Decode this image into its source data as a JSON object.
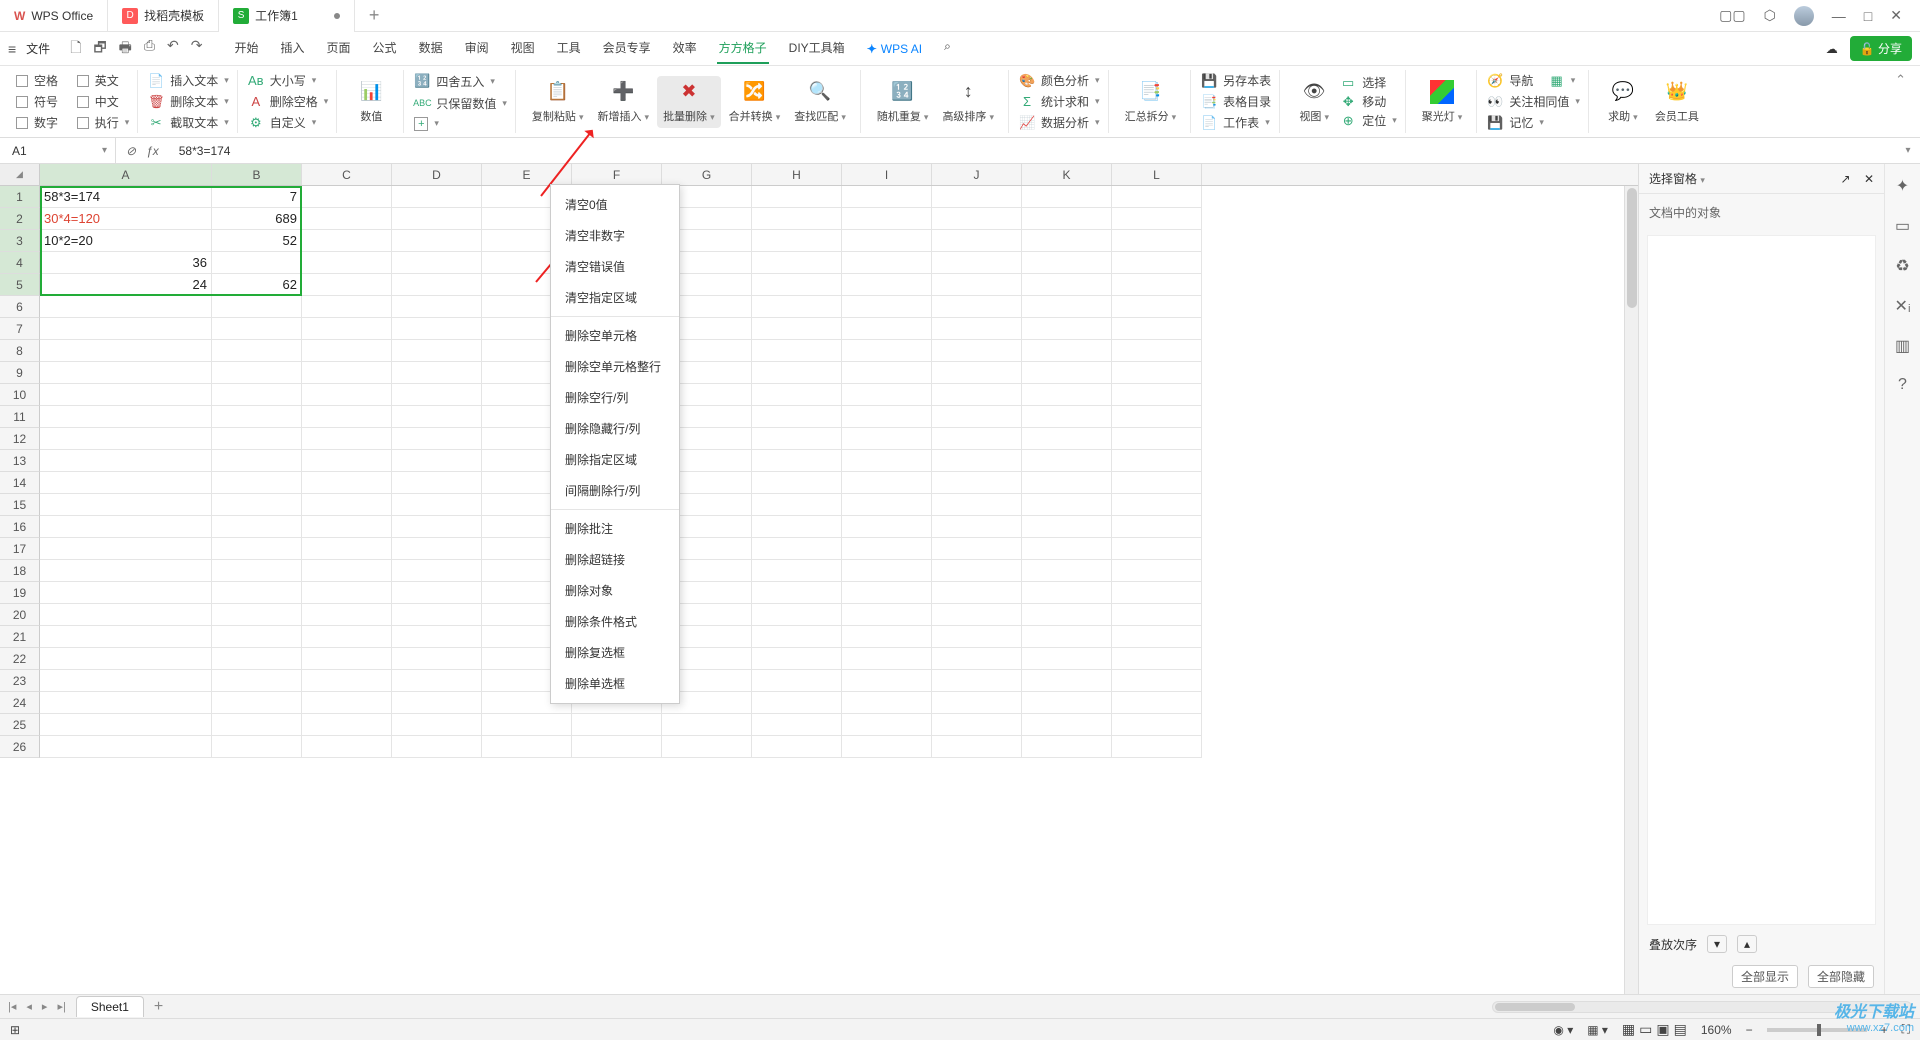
{
  "titlebar": {
    "app_name": "WPS Office",
    "tab_template": "找稻壳模板",
    "workbook": "工作簿1",
    "icons": {
      "cube": "⬡",
      "minimize": "—",
      "maxrestore": "▢▢",
      "maximize": "□",
      "close": "✕"
    }
  },
  "menubar": {
    "file": "文件",
    "quick": [
      "🗋",
      "🗗",
      "🖶",
      "⎙",
      "↶",
      "↷"
    ],
    "tabs": [
      "开始",
      "插入",
      "页面",
      "公式",
      "数据",
      "审阅",
      "视图",
      "工具",
      "会员专享",
      "效率",
      "方方格子",
      "DIY工具箱"
    ],
    "ai_label": "WPS AI",
    "search_icon": "⌕",
    "cloud_icon": "☁",
    "share": "分享"
  },
  "ribbon": {
    "g1": {
      "blank": "空格",
      "en": "英文",
      "sym": "符号",
      "cn": "中文",
      "num": "数字",
      "exec": "执行"
    },
    "g2": {
      "instxt": "插入文本",
      "deltxt": "删除文本",
      "cuttxt": "截取文本"
    },
    "g3": {
      "case": "大小写",
      "delsp": "删除空格",
      "custom": "自定义"
    },
    "g4": {
      "numval": "数值"
    },
    "g5": {
      "round": "四舍五入",
      "keepnum": "只保留数值",
      "plus": "+"
    },
    "g6": {
      "copypaste": "复制粘贴",
      "newins": "新增插入",
      "batchdel": "批量删除",
      "mergeconv": "合并转换",
      "findmatch": "查找匹配"
    },
    "g7": {
      "randrep": "随机重复",
      "advsort": "高级排序"
    },
    "g8": {
      "coloranalyze": "颜色分析",
      "statsum": "统计求和",
      "dataanalyze": "数据分析"
    },
    "g9": {
      "sumsplit": "汇总拆分"
    },
    "g10": {
      "savetbl": "另存本表",
      "tbltoc": "表格目录",
      "wksheet": "工作表"
    },
    "g11": {
      "view": "视图",
      "select": "选择",
      "move": "移动",
      "locate": "定位"
    },
    "g12": {
      "spotlight": "聚光灯"
    },
    "g13": {
      "nav": "导航",
      "watchsame": "关注相同值",
      "memory": "记忆"
    },
    "g14": {
      "help": "求助",
      "memtool": "会员工具"
    }
  },
  "fbar": {
    "name": "A1",
    "formula": "58*3=174"
  },
  "columns": [
    "A",
    "B",
    "C",
    "D",
    "E",
    "F",
    "G",
    "H",
    "I",
    "J",
    "K",
    "L"
  ],
  "rowcount": 26,
  "cellsA": [
    "58*3=174",
    "30*4=120",
    "10*2=20",
    "36",
    "24"
  ],
  "cellsB": [
    "7",
    "689",
    "52",
    "",
    "62"
  ],
  "cellsA_numflag": [
    false,
    false,
    false,
    true,
    true
  ],
  "cellsA_red": [
    false,
    true,
    false,
    false,
    false
  ],
  "dropdown": {
    "items": [
      "清空0值",
      "清空非数字",
      "清空错误值",
      "清空指定区域",
      "删除空单元格",
      "删除空单元格整行",
      "删除空行/列",
      "删除隐藏行/列",
      "删除指定区域",
      "间隔删除行/列",
      "删除批注",
      "删除超链接",
      "删除对象",
      "删除条件格式",
      "删除复选框",
      "删除单选框"
    ],
    "seps_after": [
      3,
      9
    ]
  },
  "sidepane": {
    "title": "选择窗格",
    "subtitle": "文档中的对象",
    "stack_label": "叠放次序",
    "show_all": "全部显示",
    "hide_all": "全部隐藏"
  },
  "sidetool": [
    "✦",
    "▭",
    "♻",
    "✕ᵢ",
    "▥",
    "?"
  ],
  "sheetbar": {
    "sheet": "Sheet1"
  },
  "statusbar": {
    "views": [
      "▦",
      "▭",
      "▣",
      "▤"
    ],
    "zoom": "160%"
  },
  "watermark": {
    "brand": "极光下载站",
    "url": "www.xz7.com"
  }
}
